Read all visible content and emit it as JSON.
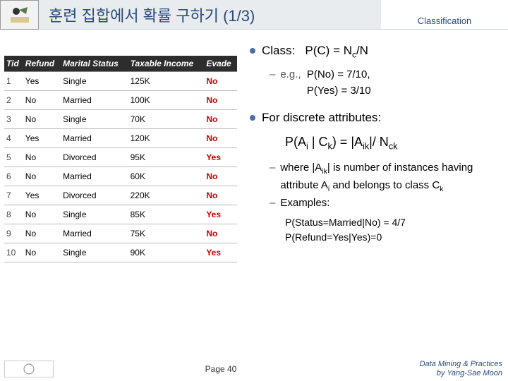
{
  "header": {
    "title": "훈련 집합에서 확률 구하기 (1/3)",
    "right": "Classification"
  },
  "table": {
    "headers": [
      "Tid",
      "Refund",
      "Marital Status",
      "Taxable Income",
      "Evade"
    ],
    "rows": [
      {
        "tid": "1",
        "refund": "Yes",
        "marital": "Single",
        "income": "125K",
        "evade": "No"
      },
      {
        "tid": "2",
        "refund": "No",
        "marital": "Married",
        "income": "100K",
        "evade": "No"
      },
      {
        "tid": "3",
        "refund": "No",
        "marital": "Single",
        "income": "70K",
        "evade": "No"
      },
      {
        "tid": "4",
        "refund": "Yes",
        "marital": "Married",
        "income": "120K",
        "evade": "No"
      },
      {
        "tid": "5",
        "refund": "No",
        "marital": "Divorced",
        "income": "95K",
        "evade": "Yes"
      },
      {
        "tid": "6",
        "refund": "No",
        "marital": "Married",
        "income": "60K",
        "evade": "No"
      },
      {
        "tid": "7",
        "refund": "Yes",
        "marital": "Divorced",
        "income": "220K",
        "evade": "No"
      },
      {
        "tid": "8",
        "refund": "No",
        "marital": "Single",
        "income": "85K",
        "evade": "Yes"
      },
      {
        "tid": "9",
        "refund": "No",
        "marital": "Married",
        "income": "75K",
        "evade": "No"
      },
      {
        "tid": "10",
        "refund": "No",
        "marital": "Single",
        "income": "90K",
        "evade": "Yes"
      }
    ]
  },
  "content": {
    "class_label": "Class:",
    "class_formula": "P(C) = N",
    "class_formula_sub1": "c",
    "class_formula_tail": "/N",
    "eg_label": "e.g.,",
    "eg1": "P(No) = 7/10,",
    "eg2": "P(Yes) = 3/10",
    "discrete_label": "For discrete attributes:",
    "discrete_formula_p1": "P(A",
    "discrete_formula_p2": " | C",
    "discrete_formula_p3": ") = |A",
    "discrete_formula_p4": "|/ N",
    "where": "where |A",
    "where_mid": "| is number of instances having attribute A",
    "where_tail": " and belongs to class C",
    "examples_label": "Examples:",
    "ex1": "P(Status=Married|No) = 4/7",
    "ex2": "P(Refund=Yes|Yes)=0"
  },
  "footer": {
    "page": "Page 40",
    "credit1": "Data Mining & Practices",
    "credit2": "by Yang-Sae Moon"
  }
}
